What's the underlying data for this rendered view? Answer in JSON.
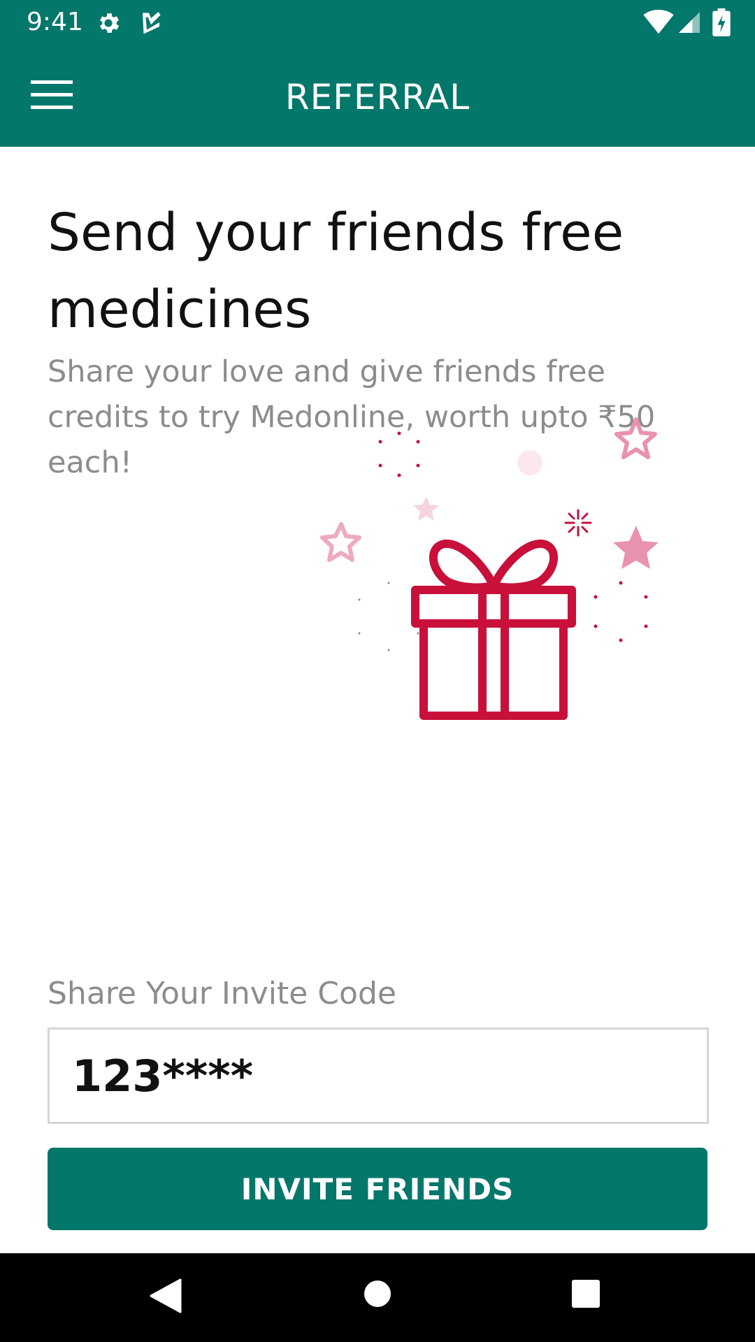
{
  "status_bar": {
    "time": "9:41",
    "icons": [
      "gear-icon",
      "check-notification-icon",
      "wifi-icon",
      "signal-icon",
      "battery-charging-icon"
    ]
  },
  "app_bar": {
    "title": "REFERRAL",
    "menu_icon": "hamburger-menu-icon"
  },
  "content": {
    "headline": "Send your friends free medicines",
    "subtext": "Share your love and give friends free credits to try Medonline, worth upto ₹50 each!",
    "illustration_icon": "gift-icon"
  },
  "invite": {
    "label": "Share Your Invite Code",
    "code": "123****",
    "button_label": "INVITE FRIENDS"
  },
  "nav_bar": {
    "icons": [
      "back-icon",
      "home-icon",
      "recents-icon"
    ]
  },
  "colors": {
    "primary": "#04776b",
    "gift": "#c8103a",
    "star_pink": "#e892ae",
    "text_dark": "#111111",
    "text_muted": "#8c8c8c"
  }
}
